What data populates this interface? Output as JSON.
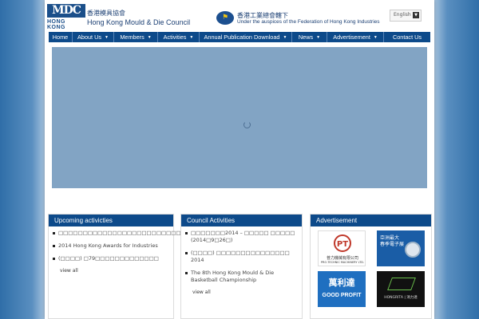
{
  "header": {
    "logo_mark": "MDC",
    "logo_sub": "HONG KONG",
    "org_name_zh": "香港模具協會",
    "org_name_en": "Hong Kong Mould & Die Council",
    "federation_zh": "香港工業總會轄下",
    "federation_en": "Under the auspices of the Federation of Hong Kong Industries",
    "language_selector": "English"
  },
  "nav": {
    "items": [
      {
        "label": "Home",
        "dropdown": false
      },
      {
        "label": "About Us",
        "dropdown": true
      },
      {
        "label": "Members",
        "dropdown": true
      },
      {
        "label": "Activities",
        "dropdown": true
      },
      {
        "label": "Annual Publication Download",
        "dropdown": true
      },
      {
        "label": "News",
        "dropdown": true
      },
      {
        "label": "Advertisement",
        "dropdown": true
      },
      {
        "label": "Contact Us",
        "dropdown": false
      }
    ]
  },
  "panels": {
    "upcoming": {
      "title": "Upcoming activicties",
      "items": [
        "□□□□□□□□□□□□□□□□□□□□□□□□□□",
        "2014 Hong Kong Awards for Industries",
        "(□□□□) □79□□□□□□□□□□□□□"
      ],
      "view_all": "view all"
    },
    "council": {
      "title": "Council Activities",
      "items": [
        "□□□□□□□2014 – □□□□□ □□□□□ (2014□9□26□)",
        "(□□□□) □□□□□□□□□□□□□□□ 2014",
        "The 8th Hong Kong Mould & Die Basketball Championship"
      ],
      "view_all": "view all"
    },
    "advertisement": {
      "title": "Advertisement",
      "ads": {
        "pt": {
          "mark": "PT",
          "name_zh": "普力機械有限公司",
          "name_en": "PRO-TECHNIC MACHINERY LTD."
        },
        "asia": {
          "line1": "亞洲最大",
          "line2": "春季電子展"
        },
        "good_profit": {
          "name_zh": "萬利達",
          "name_en": "GOOD PROFIT"
        },
        "hongrita": {
          "text": "HONGRITA | 鴻力達"
        }
      }
    }
  }
}
